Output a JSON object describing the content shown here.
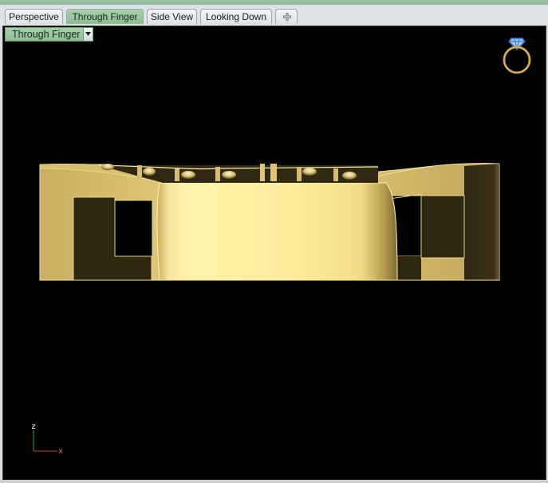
{
  "tabs": [
    {
      "label": "Perspective",
      "active": false
    },
    {
      "label": "Through Finger",
      "active": true
    },
    {
      "label": "Side View",
      "active": false
    },
    {
      "label": "Looking Down",
      "active": false
    }
  ],
  "add_tab_icon": "plus-icon",
  "viewport": {
    "label": "Through Finger",
    "dropdown_icon": "triangle-down-icon",
    "background": "#000000",
    "gold_color": "#e8cf7a",
    "highlight_color": "#fff0a0"
  },
  "axis": {
    "z_label": "z",
    "x_label": "x"
  },
  "ring_icon": "ring-icon"
}
